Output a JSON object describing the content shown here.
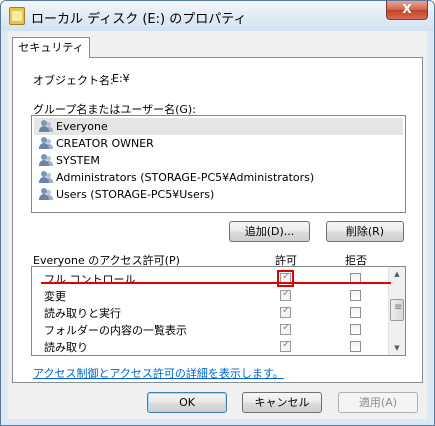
{
  "window": {
    "title": "ローカル ディスク (E:) のプロパティ",
    "close_glyph": "X"
  },
  "tab": {
    "label": "セキュリティ"
  },
  "object": {
    "label": "オブジェクト名:",
    "value": "E:¥"
  },
  "groups": {
    "label": "グループ名またはユーザー名(G):",
    "items": [
      {
        "name": "Everyone",
        "selected": true
      },
      {
        "name": "CREATOR OWNER",
        "selected": false
      },
      {
        "name": "SYSTEM",
        "selected": false
      },
      {
        "name": "Administrators (STORAGE-PC5¥Administrators)",
        "selected": false
      },
      {
        "name": "Users (STORAGE-PC5¥Users)",
        "selected": false
      }
    ],
    "add_button": "追加(D)...",
    "remove_button": "削除(R)"
  },
  "permissions": {
    "label": "Everyone のアクセス許可(P)",
    "allow_header": "許可",
    "deny_header": "拒否",
    "rows": [
      {
        "name": "フル コントロール",
        "allow": true,
        "deny": false,
        "highlighted": true
      },
      {
        "name": "変更",
        "allow": true,
        "deny": false
      },
      {
        "name": "読み取りと実行",
        "allow": true,
        "deny": false
      },
      {
        "name": "フォルダーの内容の一覧表示",
        "allow": true,
        "deny": false
      },
      {
        "name": "読み取り",
        "allow": true,
        "deny": false
      }
    ]
  },
  "help_link": "アクセス制御とアクセス許可の詳細を表示します。",
  "footer": {
    "ok": "OK",
    "cancel": "キャンセル",
    "apply": "適用(A)"
  },
  "colors": {
    "highlight": "#e00000",
    "link": "#0066cc"
  }
}
